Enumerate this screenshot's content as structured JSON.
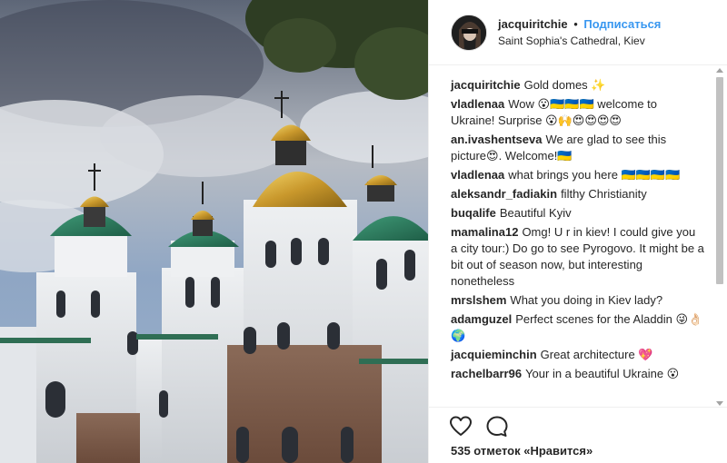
{
  "header": {
    "username": "jacquiritchie",
    "separator": "•",
    "follow_label": "Подписаться",
    "location": "Saint Sophia's Cathedral, Kiev"
  },
  "comments": [
    {
      "user": "jacquiritchie",
      "text": "Gold domes ✨"
    },
    {
      "user": "vladlenaa",
      "text": "Wow 😮🇺🇦🇺🇦🇺🇦 welcome to Ukraine! Surprise 😮🙌😍😍😍😍"
    },
    {
      "user": "an.ivashentseva",
      "text": "We are glad to see this picture😍. Welcome!🇺🇦"
    },
    {
      "user": "vladlenaa",
      "text": "what brings you here 🇺🇦🇺🇦🇺🇦🇺🇦"
    },
    {
      "user": "aleksandr_fadiakin",
      "text": "filthy Christianity"
    },
    {
      "user": "buqalife",
      "text": "Beautiful Kyiv"
    },
    {
      "user": "mamalina12",
      "text": "Omg! U r in kiev! I could give you a city tour:) Do go to see Pyrogovo. It might be a bit out of season now, but interesting nonetheless"
    },
    {
      "user": "mrslshem",
      "text": "What you doing in Kiev lady?"
    },
    {
      "user": "adamguzel",
      "text": "Perfect scenes for the Aladdin 😜👌🏻🌍"
    },
    {
      "user": "jacquieminchin",
      "text": "Great architecture 💖"
    },
    {
      "user": "rachelbarr96",
      "text": "Your in a beautiful Ukraine 😮"
    }
  ],
  "actions": {
    "like_icon": "heart-icon",
    "comment_icon": "comment-icon",
    "likes_text": "535 отметок «Нравится»"
  },
  "colors": {
    "accent": "#3897f0",
    "text": "#262626",
    "border": "#efefef"
  }
}
